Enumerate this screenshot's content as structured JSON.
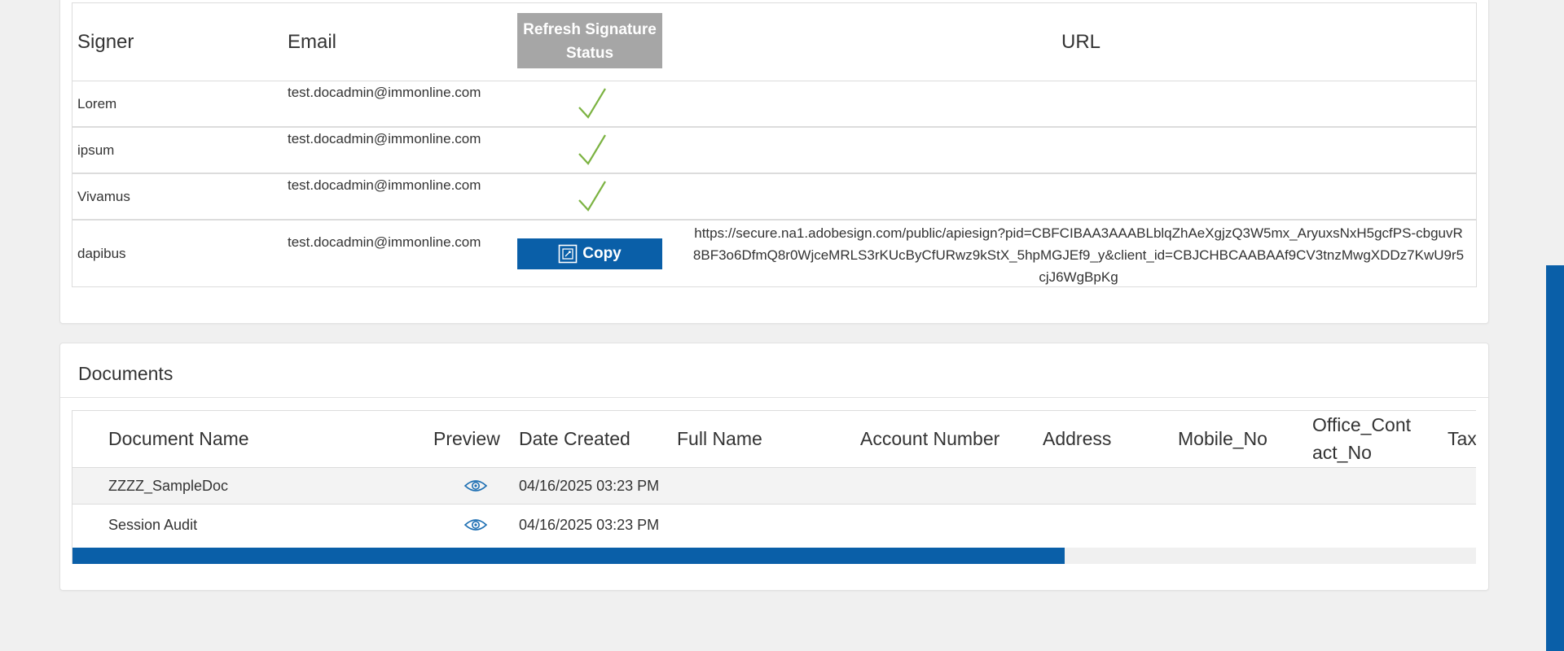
{
  "signers_table": {
    "headers": {
      "signer": "Signer",
      "email": "Email",
      "url": "URL"
    },
    "refresh_button_label": "Refresh Signature Status",
    "rows": [
      {
        "signer": "Lorem",
        "email": "test.docadmin@immonline.com",
        "status": "signed-check"
      },
      {
        "signer": "ipsum",
        "email": "test.docadmin@immonline.com",
        "status": "signed-check"
      },
      {
        "signer": "Vivamus",
        "email": "test.docadmin@immonline.com",
        "status": "signed-check"
      },
      {
        "signer": "dapibus",
        "email": "test.docadmin@immonline.com",
        "status": "pending",
        "copy_label": "Copy",
        "url": "https://secure.na1.adobesign.com/public/apiesign?pid=CBFCIBAA3AAABLblqZhAeXgjzQ3W5mx_AryuxsNxH5gcfPS-cbguvR8BF3o6DfmQ8r0WjceMRLS3rKUcByCfURwz9kStX_5hpMGJEf9_y&client_id=CBJCHBCAABAAf9CV3tnzMwgXDDz7KwU9r5cjJ6WgBpKg"
      }
    ]
  },
  "documents": {
    "title": "Documents",
    "columns": [
      "Document Name",
      "Preview",
      "Date Created",
      "Full Name",
      "Account Number",
      "Address",
      "Mobile_No",
      "Office_Contact_No",
      "Tax"
    ],
    "rows": [
      {
        "name": "ZZZZ_SampleDoc",
        "date": "04/16/2025 03:23 PM"
      },
      {
        "name": "Session Audit",
        "date": "04/16/2025 03:23 PM"
      }
    ],
    "horizontal_scroll_fraction": 0.707
  },
  "colors": {
    "accent": "#0a5fa8",
    "check": "#7cb342",
    "refresh_button": "#a6a6a6",
    "page_background": "#f0f0f0"
  },
  "icons": {
    "check": "check-icon",
    "copy": "copy-icon",
    "preview": "eye-icon"
  }
}
